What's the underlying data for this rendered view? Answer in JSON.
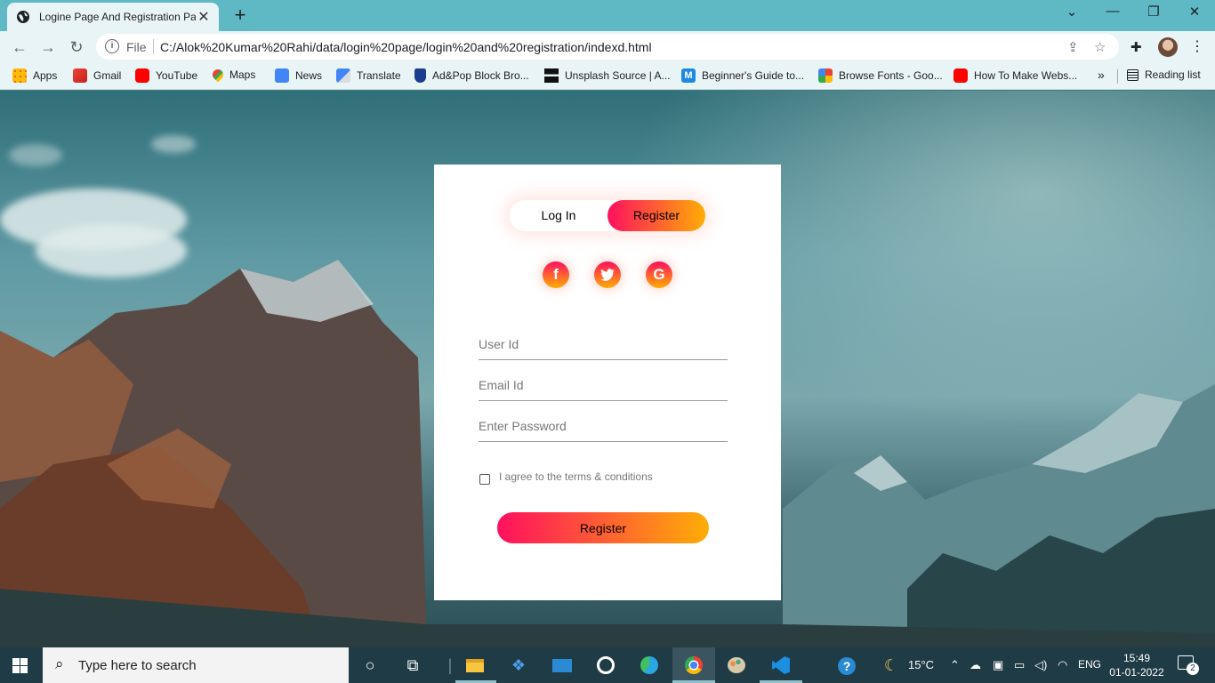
{
  "browser": {
    "tab_title": "Logine Page And Registration Page",
    "file_label": "File",
    "url": "C:/Alok%20Kumar%20Rahi/data/login%20page/login%20and%20registration/indexd.html",
    "bookmarks": [
      {
        "label": "Apps",
        "icon": "apps-grid-icon",
        "color": "#4285f4"
      },
      {
        "label": "Gmail",
        "icon": "gmail-icon",
        "color": "#ea4335"
      },
      {
        "label": "YouTube",
        "icon": "youtube-icon",
        "color": "#ff0000"
      },
      {
        "label": "Maps",
        "icon": "maps-icon",
        "color": "#34a853"
      },
      {
        "label": "News",
        "icon": "news-icon",
        "color": "#4285f4"
      },
      {
        "label": "Translate",
        "icon": "translate-icon",
        "color": "#4285f4"
      },
      {
        "label": "Ad&Pop Block Bro...",
        "icon": "shield-icon",
        "color": "#1a3d8f"
      },
      {
        "label": "Unsplash Source | A...",
        "icon": "unsplash-icon",
        "color": "#111111"
      },
      {
        "label": "Beginner's Guide to...",
        "icon": "m-icon",
        "color": "#1e88e5"
      },
      {
        "label": "Browse Fonts - Goo...",
        "icon": "fonts-icon",
        "color": "#ea4335"
      },
      {
        "label": "How To Make Webs...",
        "icon": "youtube-icon",
        "color": "#ff0000"
      }
    ],
    "more_bookmarks": "»",
    "reading_list": "Reading list"
  },
  "card": {
    "toggle_login": "Log In",
    "toggle_register": "Register",
    "social": [
      {
        "label": "f",
        "icon": "facebook-icon"
      },
      {
        "label": "t",
        "icon": "twitter-icon"
      },
      {
        "label": "G",
        "icon": "google-icon"
      }
    ],
    "user_id_placeholder": "User Id",
    "email_placeholder": "Email Id",
    "password_placeholder": "Enter Password",
    "agree_label": "I agree to the terms & conditions",
    "submit_label": "Register",
    "accent_start": "#ff105f",
    "accent_end": "#ffad06"
  },
  "taskbar": {
    "search_placeholder": "Type here to search",
    "weather_temp": "15°C",
    "language": "ENG",
    "time": "15:49",
    "date": "01-01-2022",
    "notifications": "2"
  }
}
